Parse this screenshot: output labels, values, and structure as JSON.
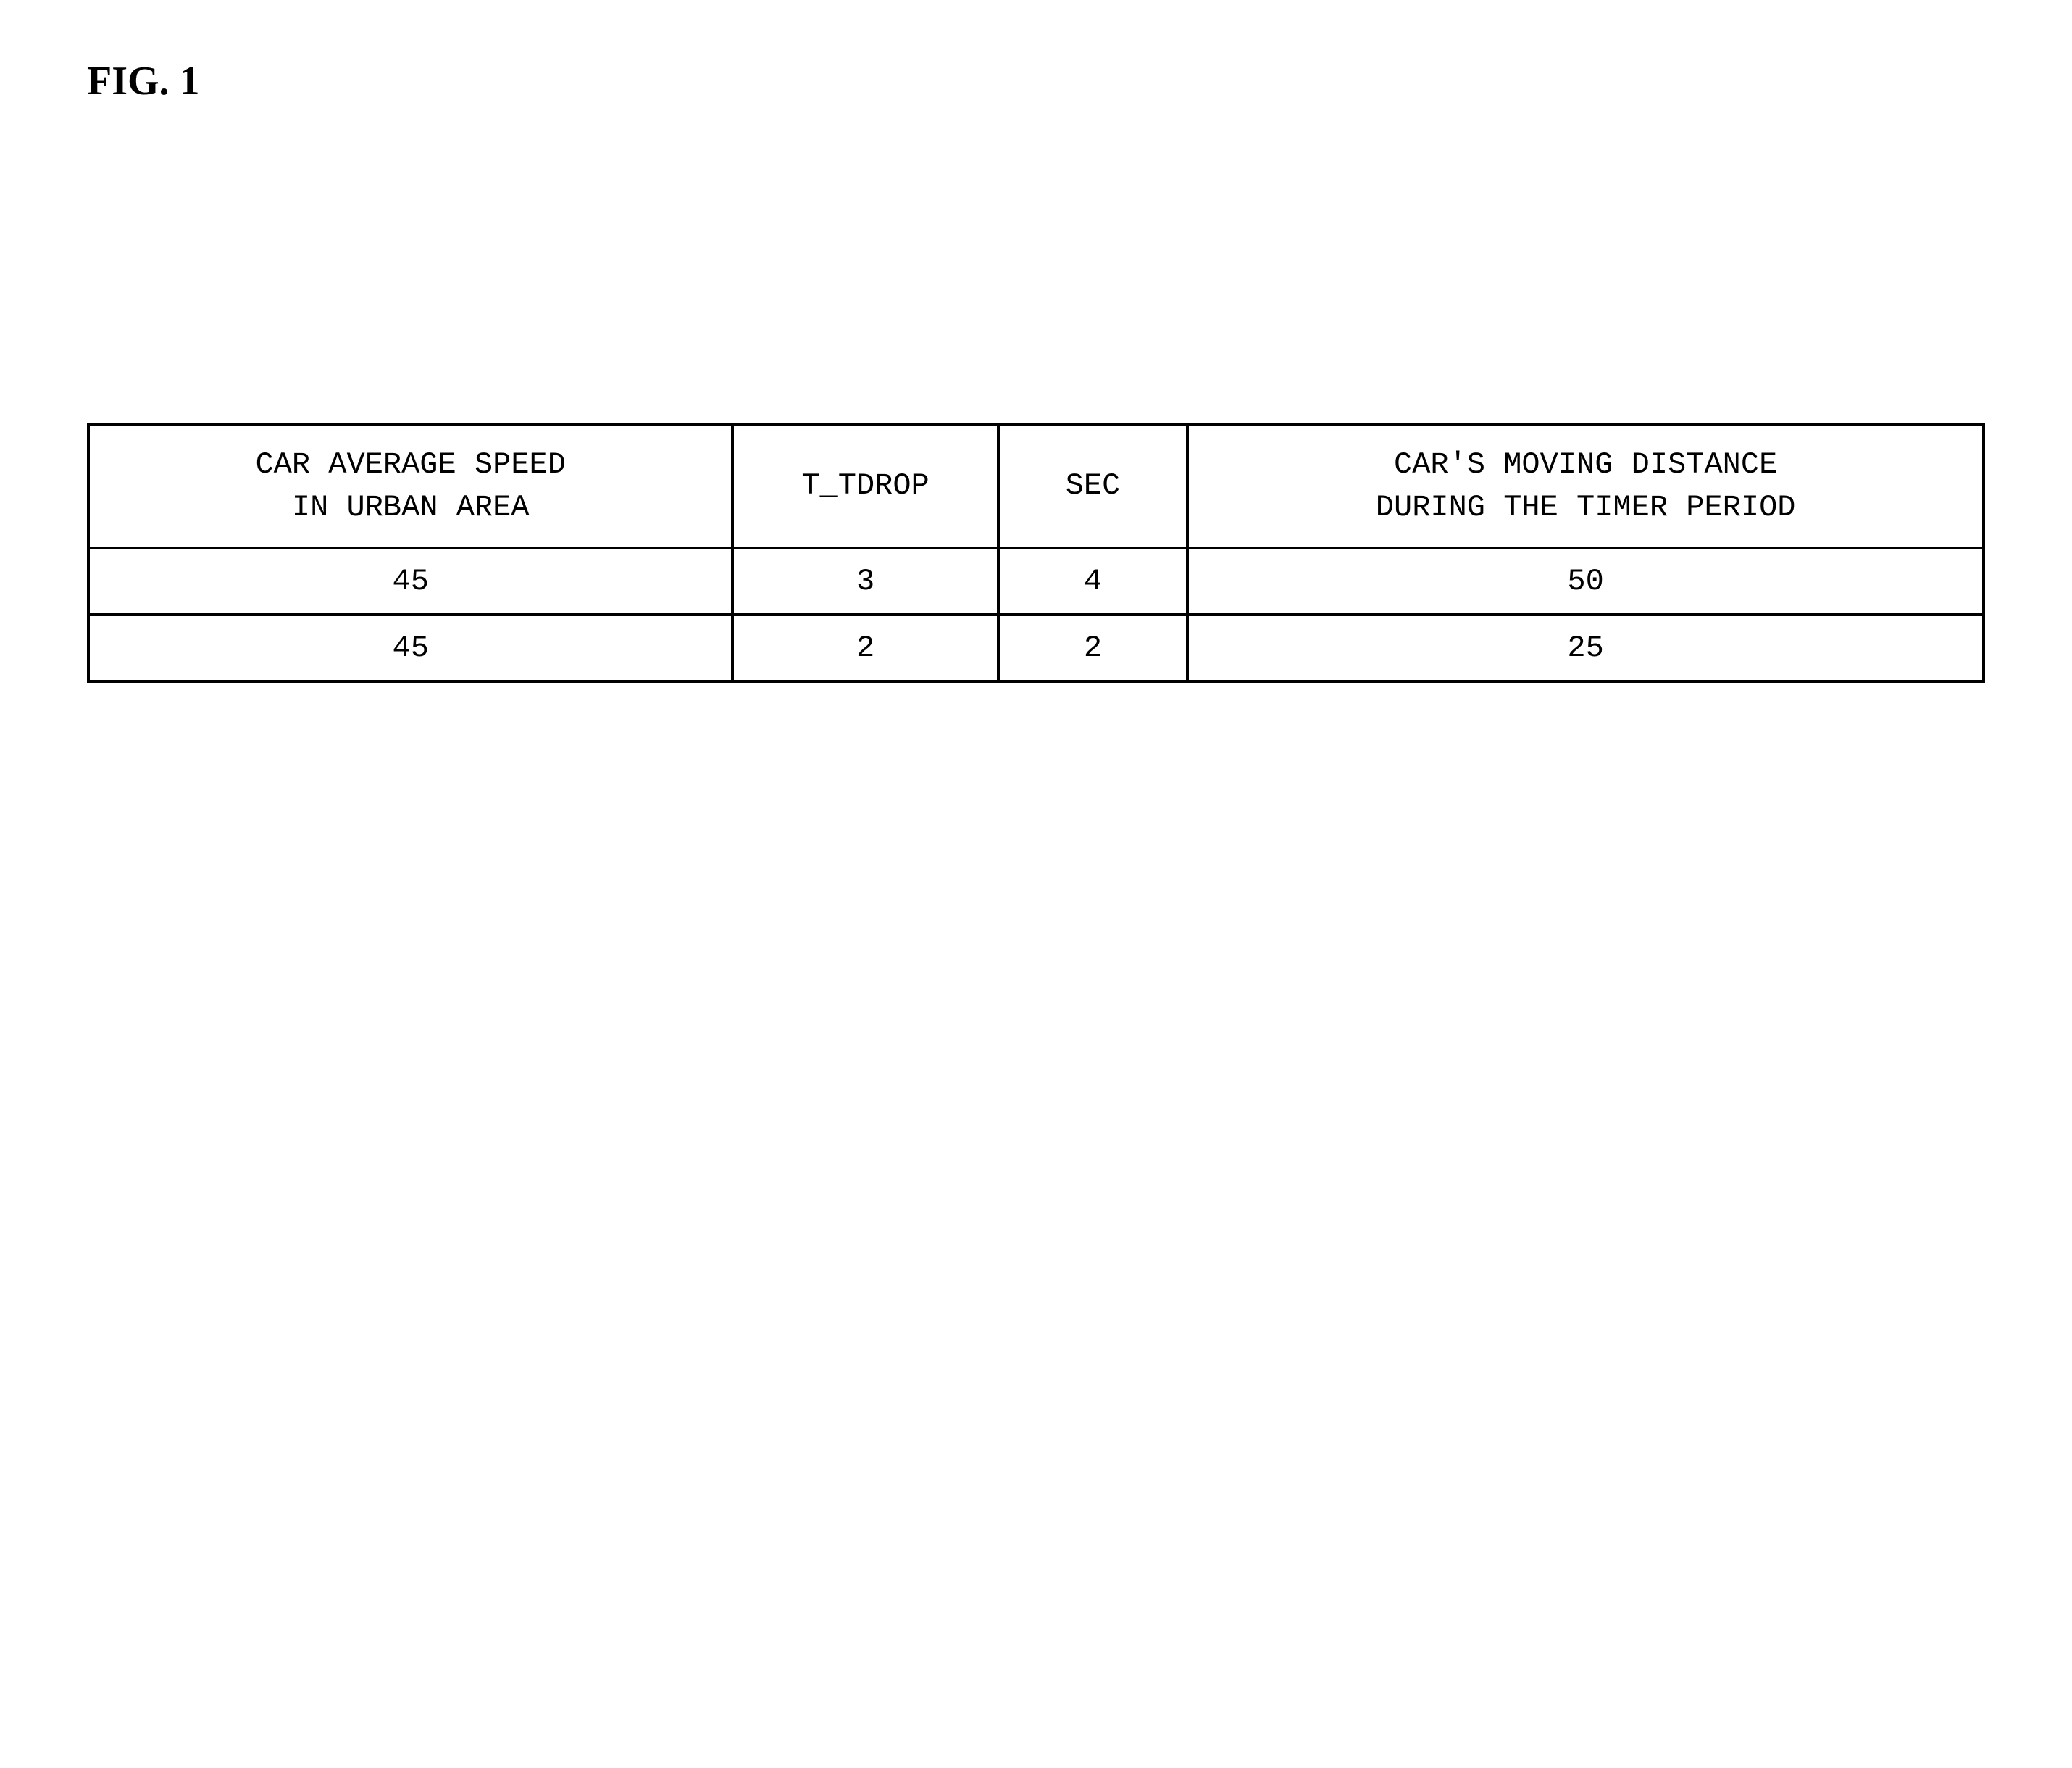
{
  "figure_title": "FIG. 1",
  "table": {
    "headers": {
      "col0": "CAR AVERAGE SPEED\nIN URBAN AREA",
      "col1": "T_TDROP",
      "col2": "SEC",
      "col3": "CAR'S MOVING DISTANCE\nDURING THE TIMER PERIOD"
    },
    "rows": [
      {
        "speed": "45",
        "tdrop": "3",
        "sec": "4",
        "dist": "50"
      },
      {
        "speed": "45",
        "tdrop": "2",
        "sec": "2",
        "dist": "25"
      }
    ]
  }
}
